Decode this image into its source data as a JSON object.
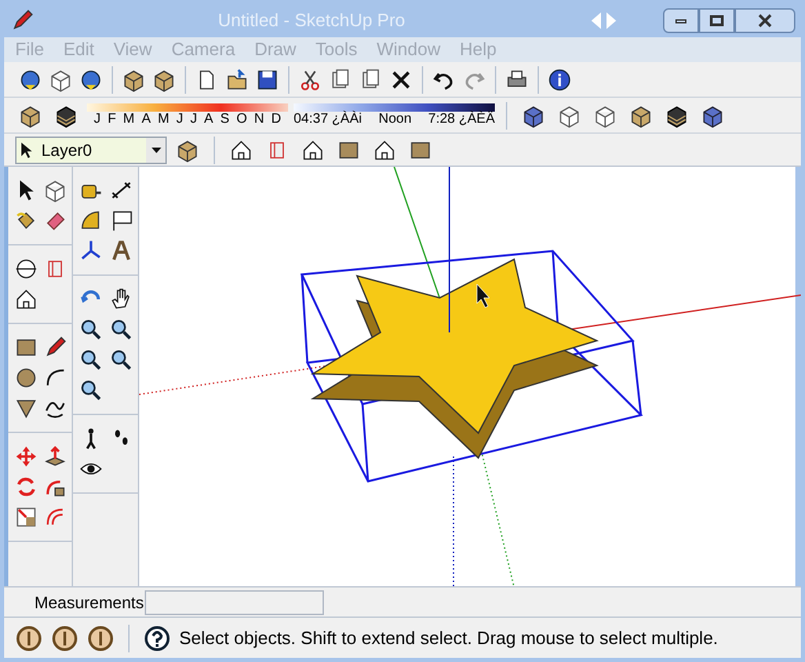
{
  "window": {
    "title": "Untitled - SketchUp Pro",
    "active": false
  },
  "menu": [
    "File",
    "Edit",
    "View",
    "Camera",
    "Draw",
    "Tools",
    "Window",
    "Help"
  ],
  "shadow_settings": {
    "months": [
      "J",
      "F",
      "M",
      "A",
      "M",
      "J",
      "J",
      "A",
      "S",
      "O",
      "N",
      "D"
    ],
    "time_start": "04:37 ¿ÀÀi",
    "time_mid": "Noon",
    "time_end": "7:28 ¿ÀÈÄ"
  },
  "layer_select": {
    "value": "Layer0"
  },
  "measurements": {
    "label": "Measurements"
  },
  "status_bar": {
    "text": "Select objects. Shift to extend select. Drag mouse to select multiple."
  }
}
